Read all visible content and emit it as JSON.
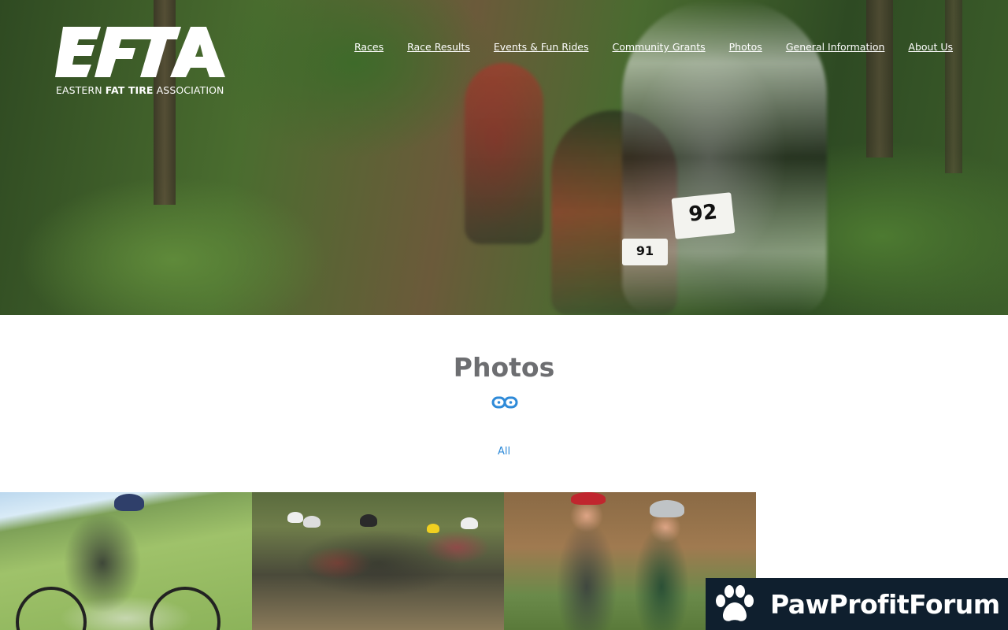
{
  "site": {
    "logo_letters": "EFTA",
    "logo_tagline_pre": "EASTERN ",
    "logo_tagline_bold": "FAT TIRE",
    "logo_tagline_post": " ASSOCIATION"
  },
  "nav": {
    "items": [
      {
        "label": "Races"
      },
      {
        "label": "Race Results"
      },
      {
        "label": "Events & Fun Rides"
      },
      {
        "label": "Community Grants"
      },
      {
        "label": "Photos"
      },
      {
        "label": "General Information"
      },
      {
        "label": "About Us"
      }
    ]
  },
  "hero": {
    "plate_main": "92",
    "plate_second": "91"
  },
  "section": {
    "title": "Photos",
    "divider_icon": "chain-link-icon"
  },
  "filters": {
    "active": "All"
  },
  "gallery": {
    "photos": [
      {
        "subject": "mountain biker riding on grassy hill"
      },
      {
        "subject": "group of racers at start line"
      },
      {
        "subject": "two smiling muddy riders"
      }
    ]
  },
  "watermark": {
    "text": "PawProfitForum",
    "icon": "paw-icon"
  },
  "colors": {
    "accent": "#2e8ad8",
    "title": "#6d6e71",
    "watermark_bg": "#0f1f2e"
  }
}
